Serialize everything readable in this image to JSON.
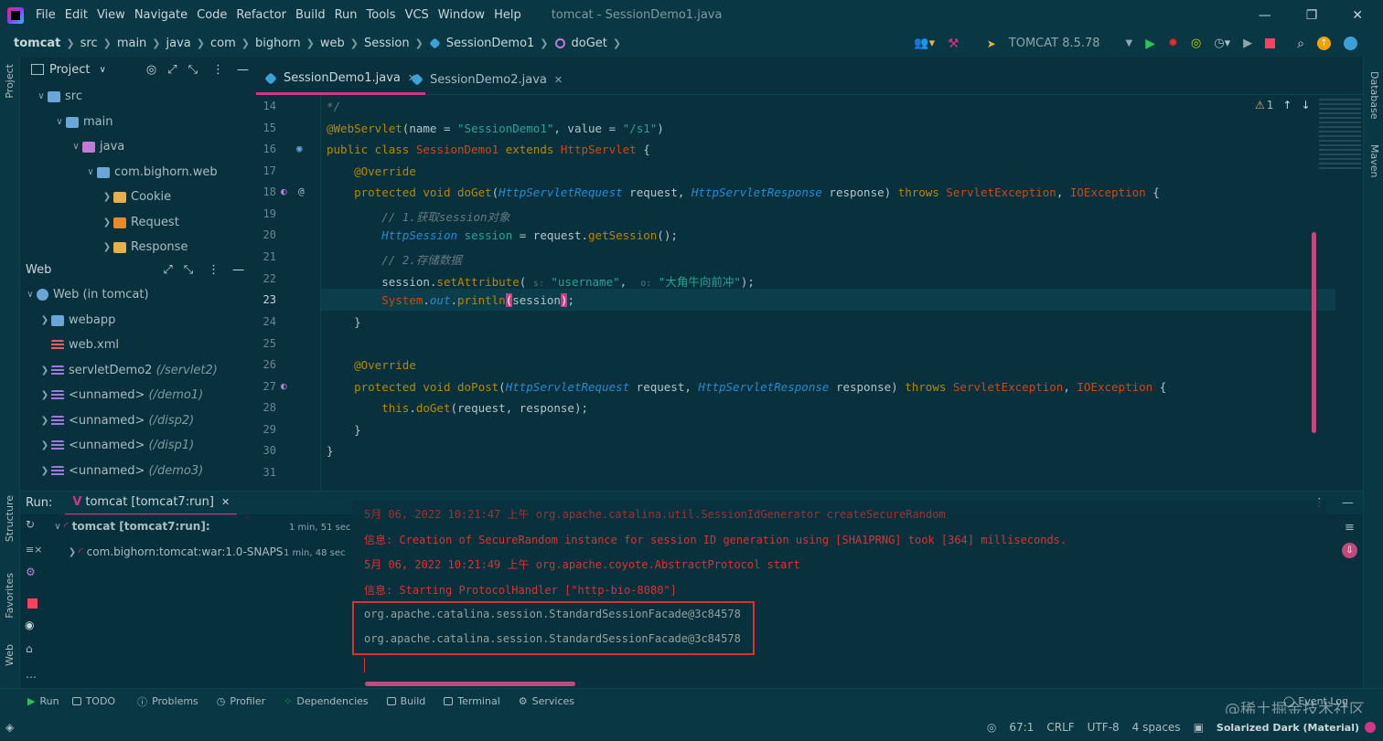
{
  "menu": {
    "items": [
      "File",
      "Edit",
      "View",
      "Navigate",
      "Code",
      "Refactor",
      "Build",
      "Run",
      "Tools",
      "VCS",
      "Window",
      "Help"
    ],
    "window_title": "tomcat - SessionDemo1.java"
  },
  "breadcrumb": {
    "items": [
      "tomcat",
      "src",
      "main",
      "java",
      "com",
      "bighorn",
      "web",
      "Session",
      "SessionDemo1",
      "doGet"
    ]
  },
  "toolbar": {
    "run_config": "TOMCAT 8.5.78"
  },
  "left_strip": {
    "project": "Project",
    "structure": "Structure",
    "favorites": "Favorites",
    "web": "Web"
  },
  "right_strip": {
    "database": "Database",
    "maven": "Maven"
  },
  "project_panel": {
    "title": "Project",
    "tree": [
      {
        "label": "src"
      },
      {
        "label": "main"
      },
      {
        "label": "java"
      },
      {
        "label": "com.bighorn.web"
      },
      {
        "label": "Cookie"
      },
      {
        "label": "Request"
      },
      {
        "label": "Response"
      }
    ]
  },
  "web_panel": {
    "title": "Web",
    "tree": [
      {
        "label": "Web (in tomcat)"
      },
      {
        "label": "webapp"
      },
      {
        "label": "web.xml"
      },
      {
        "label": "servletDemo2",
        "path": "(/servlet2)"
      },
      {
        "label": "<unnamed>",
        "path": "(/demo1)"
      },
      {
        "label": "<unnamed>",
        "path": "(/disp2)"
      },
      {
        "label": "<unnamed>",
        "path": "(/disp1)"
      },
      {
        "label": "<unnamed>",
        "path": "(/demo3)"
      }
    ]
  },
  "editor": {
    "tabs": [
      {
        "label": "SessionDemo1.java",
        "active": true
      },
      {
        "label": "SessionDemo2.java",
        "active": false
      }
    ],
    "warning_count": "1",
    "line_numbers": [
      "14",
      "15",
      "16",
      "17",
      "18",
      "19",
      "20",
      "21",
      "22",
      "23",
      "24",
      "25",
      "26",
      "27",
      "28",
      "29",
      "30",
      "31"
    ],
    "current_line": "23"
  },
  "run_panel": {
    "label": "Run:",
    "tab": "tomcat [tomcat7:run]",
    "tree": [
      {
        "label": "tomcat [tomcat7:run]:",
        "time": "1 min, 51 sec"
      },
      {
        "label": "com.bighorn:tomcat:war:1.0-SNAPS",
        "time": "1 min, 48 sec"
      }
    ],
    "console": [
      {
        "text": "5月 06, 2022 10:21:47 上午 org.apache.catalina.util.SessionIdGenerator createSecureRandom",
        "color": "#dc322f"
      },
      {
        "text": "信息: Creation of SecureRandom instance for session ID generation using [SHA1PRNG] took [364] milliseconds.",
        "color": "#dc322f"
      },
      {
        "text": "5月 06, 2022 10:21:49 上午 org.apache.coyote.AbstractProtocol start",
        "color": "#dc322f"
      },
      {
        "text": "信息: Starting ProtocolHandler [\"http-bio-8080\"]",
        "color": "#dc322f"
      },
      {
        "text": "org.apache.catalina.session.StandardSessionFacade@3c84578",
        "color": "#93a1a1"
      },
      {
        "text": "org.apache.catalina.session.StandardSessionFacade@3c84578",
        "color": "#93a1a1"
      }
    ]
  },
  "bottom_tabs": [
    "Run",
    "TODO",
    "Problems",
    "Profiler",
    "Dependencies",
    "Build",
    "Terminal",
    "Services"
  ],
  "event_log": "Event Log",
  "status": {
    "position": "67:1",
    "line_sep": "CRLF",
    "encoding": "UTF-8",
    "indent": "4 spaces",
    "theme": "Solarized Dark (Material)"
  },
  "watermark": "@稀土掘金技术社区",
  "colors": {
    "background": "#08313d",
    "accent": "#d33682",
    "keyword": "#b58900",
    "string": "#2aa198",
    "class": "#cb4b16",
    "error": "#dc322f"
  }
}
